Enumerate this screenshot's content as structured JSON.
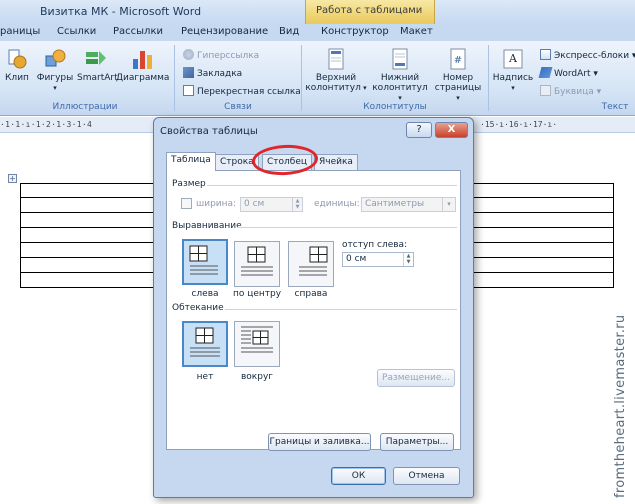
{
  "window": {
    "title": "Визитка МК - Microsoft Word",
    "contextual_group": "Работа с таблицами"
  },
  "tabs": [
    "раницы",
    "Ссылки",
    "Рассылки",
    "Рецензирование",
    "Вид",
    "Конструктор",
    "Макет"
  ],
  "ribbon": {
    "illustrations": {
      "clip": "Клип",
      "shapes": "Фигуры",
      "smartart": "SmartArt",
      "chart": "Диаграмма",
      "label": "Иллюстрации"
    },
    "links": {
      "hyperlink": "Гиперссылка",
      "bookmark": "Закладка",
      "crossref": "Перекрестная ссылка",
      "label": "Связи"
    },
    "headers": {
      "header_l1": "Верхний",
      "header_l2": "колонтитул",
      "footer_l1": "Нижний",
      "footer_l2": "колонтитул",
      "pagenum_l1": "Номер",
      "pagenum_l2": "страницы",
      "label": "Колонтитулы"
    },
    "text": {
      "textbox": "Надпись",
      "quickparts": "Экспресс-блоки",
      "wordart": "WordArt",
      "dropcap": "Буквица",
      "label": "Текст"
    }
  },
  "ruler": {
    "left": "·1·1·ı·1·2·1·3·1·4",
    "right": "·15·ı·16·ı·17·ı·"
  },
  "watermark": "fromtheheart.livemaster.ru",
  "dialog": {
    "title": "Свойства таблицы",
    "help": "?",
    "close": "X",
    "tabs": {
      "table": "Таблица",
      "row": "Строка",
      "column": "Столбец",
      "cell": "Ячейка"
    },
    "size": {
      "section": "Размер",
      "width_label": "ширина:",
      "width_value": "0 см",
      "units_label": "единицы:",
      "units_value": "Сантиметры"
    },
    "alignment": {
      "section": "Выравнивание",
      "left": "слева",
      "center": "по центру",
      "right": "справа",
      "indent_label": "отступ слева:",
      "indent_value": "0 см"
    },
    "wrapping": {
      "section": "Обтекание",
      "none": "нет",
      "around": "вокруг",
      "positioning": "Размещение..."
    },
    "borders_button": "Границы и заливка...",
    "options_button": "Параметры...",
    "ok": "ОК",
    "cancel": "Отмена"
  },
  "colors": {
    "highlight_circle": "#e0262b",
    "selected_option": "#c8e0f6"
  }
}
